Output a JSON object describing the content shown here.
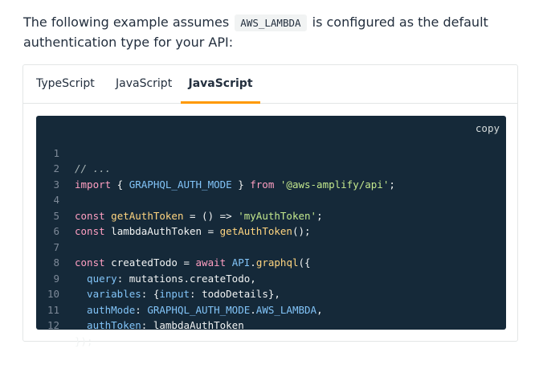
{
  "intro": {
    "before": "The following example assumes ",
    "code": "AWS_LAMBDA",
    "after": " is configured as the default authentication type for your API:"
  },
  "tabs": [
    {
      "label": "TypeScript",
      "active": false
    },
    {
      "label": "JavaScript",
      "active": false
    },
    {
      "label": "JavaScript",
      "active": true
    }
  ],
  "copy_label": "copy",
  "code_lines": [
    {
      "n": "1"
    },
    {
      "n": "2"
    },
    {
      "n": "3"
    },
    {
      "n": "4"
    },
    {
      "n": "5"
    },
    {
      "n": "6"
    },
    {
      "n": "7"
    },
    {
      "n": "8"
    },
    {
      "n": "9"
    },
    {
      "n": "10"
    },
    {
      "n": "11"
    },
    {
      "n": "12"
    }
  ],
  "code": {
    "l1": "// ...",
    "l2_kw": "import",
    "l2_a": " { ",
    "l2_b": "GRAPHQL_AUTH_MODE",
    "l2_c": " } ",
    "l2_from": "from",
    "l2_sp": " ",
    "l2_str": "'@aws-amplify/api'",
    "l2_end": ";",
    "l4_kw": "const",
    "l4_sp": " ",
    "l4_fn": "getAuthToken",
    "l4_rest": " = () => ",
    "l4_str": "'myAuthToken'",
    "l4_end": ";",
    "l5_kw": "const",
    "l5_a": " lambdaAuthToken = ",
    "l5_fn": "getAuthToken",
    "l5_end": "();",
    "l7_kw": "const",
    "l7_a": " createdTodo = ",
    "l7_await": "await",
    "l7_sp": " ",
    "l7_api": "API",
    "l7_dot": ".",
    "l7_fn": "graphql",
    "l7_end": "({",
    "l8_prop": "  query",
    "l8_rest": ": mutations.createTodo,",
    "l9_prop": "  variables",
    "l9_a": ": {",
    "l9_prop2": "input",
    "l9_rest": ": todoDetails},",
    "l10_prop": "  authMode",
    "l10_a": ": ",
    "l10_b": "GRAPHQL_AUTH_MODE",
    "l10_dot": ".",
    "l10_c": "AWS_LAMBDA",
    "l10_end": ",",
    "l11_prop": "  authToken",
    "l11_rest": ": lambdaAuthToken",
    "l12": "});"
  }
}
